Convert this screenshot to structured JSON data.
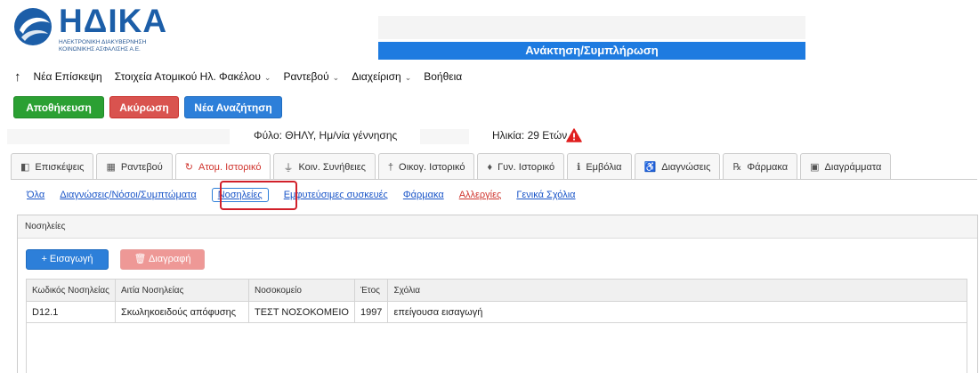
{
  "logo": {
    "title": "ΗΔΙΚΑ",
    "subtitle_line1": "ΗΛΕΚΤΡΟΝΙΚΗ ΔΙΑΚΥΒΕΡΝΗΣΗ",
    "subtitle_line2": "ΚΟΙΝΩΝΙΚΗΣ ΑΣΦΑΛΙΣΗΣ Α.Ε."
  },
  "header": {
    "title": "Ανάκτηση/Συμπλήρωση",
    "accent": "#1e7be0"
  },
  "menu": {
    "back_icon": "arrow-up-icon",
    "items": [
      {
        "label": "Νέα Επίσκεψη",
        "dropdown": false
      },
      {
        "label": "Στοιχεία Ατομικού Ηλ. Φακέλου",
        "dropdown": true
      },
      {
        "label": "Ραντεβού",
        "dropdown": true
      },
      {
        "label": "Διαχείριση",
        "dropdown": true
      },
      {
        "label": "Βοήθεια",
        "dropdown": false
      }
    ]
  },
  "toolbar": {
    "save_label": "Αποθήκευση",
    "cancel_label": "Ακύρωση",
    "new_search_label": "Νέα Αναζήτηση"
  },
  "patient": {
    "sex_dob_label": "Φύλο: ΘΗΛΥ,  Ημ/νία γέννησης",
    "age_label": "Ηλικία: 29 Ετών",
    "warning_icon": "warning-icon"
  },
  "tabs": [
    {
      "label": "Επισκέψεις",
      "icon": "◧"
    },
    {
      "label": "Ραντεβού",
      "icon": "▦"
    },
    {
      "label": "Ατομ. Ιστορικό",
      "icon": "↻"
    },
    {
      "label": "Κοιν. Συνήθειες",
      "icon": "⏚"
    },
    {
      "label": "Οικογ. Ιστορικό",
      "icon": "†"
    },
    {
      "label": "Γυν. Ιστορικό",
      "icon": "♦"
    },
    {
      "label": "Εμβόλια",
      "icon": "ℹ"
    },
    {
      "label": "Διαγνώσεις",
      "icon": "♿"
    },
    {
      "label": "Φάρμακα",
      "icon": "℞"
    },
    {
      "label": "Διαγράμματα",
      "icon": "▣"
    }
  ],
  "subtabs": [
    {
      "label": "Όλα"
    },
    {
      "label": "Διαγνώσεις/Νόσοι/Συμπτώματα"
    },
    {
      "label": "Νοσηλείες"
    },
    {
      "label": "Εμφυτεύσιμες συσκευές"
    },
    {
      "label": "Φάρμακα"
    },
    {
      "label": "Αλλεργίες"
    },
    {
      "label": "Γενικά Σχόλια"
    }
  ],
  "panel": {
    "title": "Νοσηλείες",
    "add_label": "+ Εισαγωγή",
    "delete_label": "🗑 Διαγραφή",
    "columns": [
      "Κωδικός Νοσηλείας",
      "Αιτία Νοσηλείας",
      "Νοσοκομείο",
      "Έτος",
      "Σχόλια"
    ],
    "rows": [
      [
        "D12.1",
        "Σκωληκοειδούς απόφυσης",
        "ΤΕΣΤ ΝΟΣΟΚΟΜΕΙΟ",
        "1997",
        "επείγουσα εισαγωγή"
      ]
    ]
  }
}
